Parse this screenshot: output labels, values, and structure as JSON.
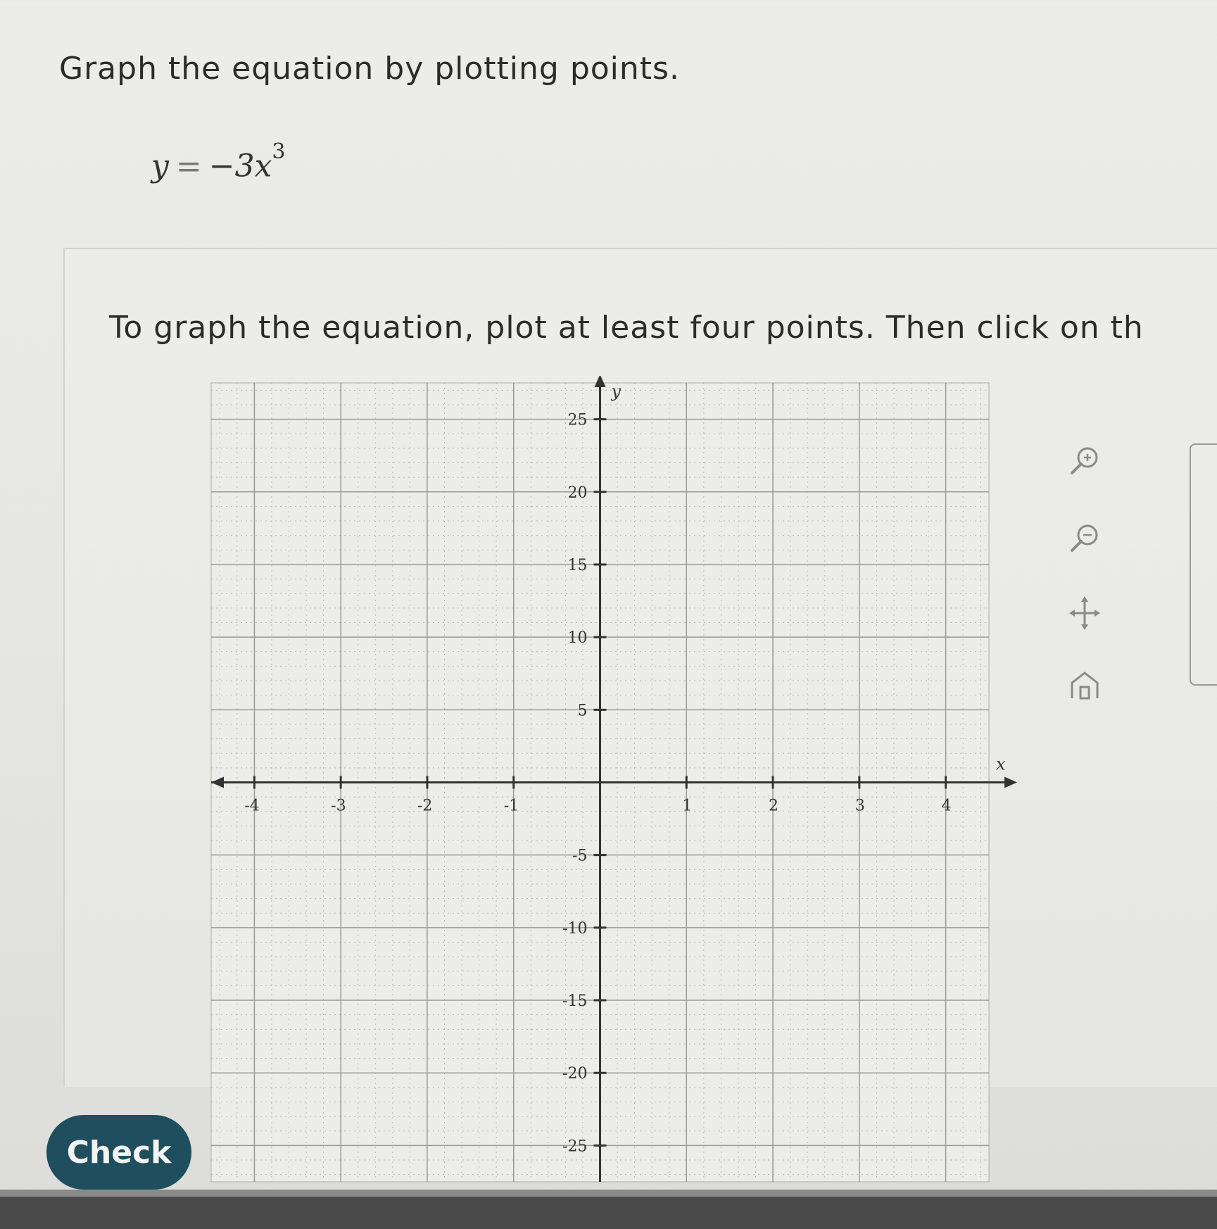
{
  "question": {
    "prompt": "Graph the equation by plotting points.",
    "equation": {
      "lhs": "y",
      "eq": "=",
      "rhs": "−3x",
      "exponent": "3"
    },
    "instruction": "To graph the equation, plot at least four points. Then click on th"
  },
  "toolbar": {
    "tools": [
      {
        "name": "zoom-in-icon"
      },
      {
        "name": "zoom-out-icon"
      },
      {
        "name": "move-arrows-icon"
      },
      {
        "name": "home-icon"
      }
    ]
  },
  "check_button": {
    "label": "Check"
  },
  "chart_data": {
    "type": "scatter",
    "title": "",
    "xlabel": "x",
    "ylabel": "y",
    "xlim": [
      -4.5,
      4.5
    ],
    "ylim": [
      -27.5,
      27.5
    ],
    "x_ticks": [
      -4,
      -3,
      -2,
      -1,
      1,
      2,
      3,
      4
    ],
    "x_tick_labels": [
      "-4",
      "-3",
      "-2",
      "-1",
      "1",
      "2",
      "3",
      "4"
    ],
    "y_ticks": [
      -25,
      -20,
      -15,
      -10,
      -5,
      5,
      10,
      15,
      20,
      25
    ],
    "y_tick_labels": [
      "-25",
      "-20",
      "-15",
      "-10",
      "-5",
      "5",
      "10",
      "15",
      "20",
      "25"
    ],
    "grid": true,
    "minor_grid": {
      "x_step": 0.2,
      "y_step": 1
    },
    "points": []
  }
}
